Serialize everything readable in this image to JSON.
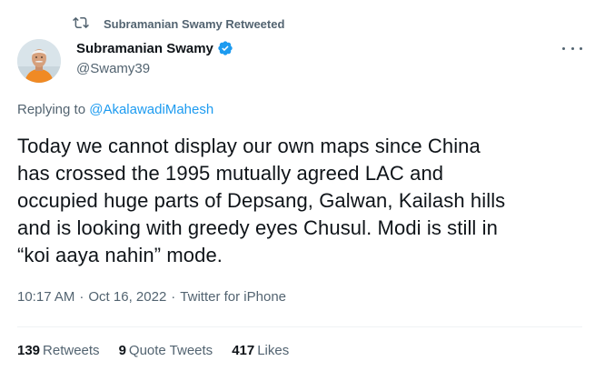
{
  "retweet_header": {
    "icon": "retweet-icon",
    "text": "Subramanian Swamy Retweeted"
  },
  "author": {
    "name": "Subramanian Swamy",
    "handle": "@Swamy39",
    "verified": true,
    "avatar_icon": "avatar"
  },
  "more_menu": {
    "icon": "more-options-icon"
  },
  "reply": {
    "prefix": "Replying to ",
    "mention": "@AkalawadiMahesh"
  },
  "tweet": {
    "line1": "Today we cannot display our own maps since China",
    "line2": "has crossed the 1995 mutually agreed LAC and",
    "line3": "occupied huge parts of Depsang, Galwan, Kailash hills",
    "line4": "and is looking with greedy eyes Chusul. Modi is still in",
    "line5": "“koi aaya nahin” mode."
  },
  "meta": {
    "time": "10:17 AM",
    "separator": "·",
    "date": "Oct 16, 2022",
    "source": "Twitter for iPhone"
  },
  "stats": {
    "retweets_count": "139",
    "retweets_label": "Retweets",
    "quotes_count": "9",
    "quotes_label": "Quote Tweets",
    "likes_count": "417",
    "likes_label": "Likes"
  },
  "colors": {
    "primary_text": "#0f1419",
    "secondary_text": "#536471",
    "link": "#1d9bf0",
    "divider": "#eff3f4",
    "verified_badge": "#1d9bf0"
  }
}
